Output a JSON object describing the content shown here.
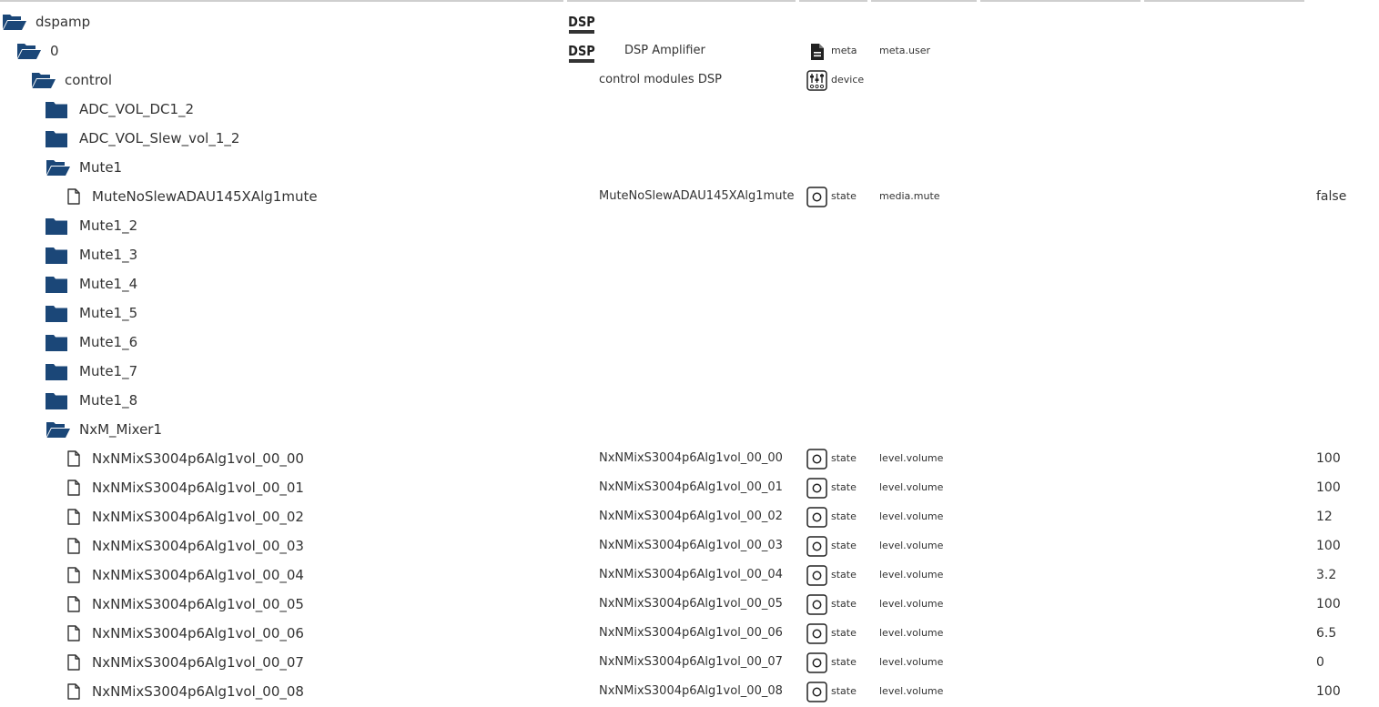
{
  "colors": {
    "folder": "#1b4778",
    "text": "#333333",
    "header_line": "#cfcfcf"
  },
  "rows": [
    {
      "kind": "folder-open",
      "label": "dspamp",
      "logo": "DSP",
      "name": "",
      "type": "",
      "type_icon": "",
      "role": "",
      "value": ""
    },
    {
      "kind": "folder-open",
      "label": "0",
      "logo": "DSP",
      "name": "DSP Amplifier",
      "type": "meta",
      "type_icon": "document-icon",
      "role": "meta.user",
      "value": ""
    },
    {
      "kind": "folder-open",
      "label": "control",
      "logo": "",
      "name": "control modules DSP",
      "type": "device",
      "type_icon": "device-icon",
      "role": "",
      "value": ""
    },
    {
      "kind": "folder",
      "label": "ADC_VOL_DC1_2",
      "name": "",
      "type": "",
      "type_icon": "",
      "role": "",
      "value": ""
    },
    {
      "kind": "folder",
      "label": "ADC_VOL_Slew_vol_1_2",
      "name": "",
      "type": "",
      "type_icon": "",
      "role": "",
      "value": ""
    },
    {
      "kind": "folder-open",
      "label": "Mute1",
      "name": "",
      "type": "",
      "type_icon": "",
      "role": "",
      "value": ""
    },
    {
      "kind": "file",
      "label": "MuteNoSlewADAU145XAlg1mute",
      "name": "MuteNoSlewADAU145XAlg1mute",
      "type": "state",
      "type_icon": "state-icon",
      "role": "media.mute",
      "value": "false"
    },
    {
      "kind": "folder",
      "label": "Mute1_2",
      "name": "",
      "type": "",
      "type_icon": "",
      "role": "",
      "value": ""
    },
    {
      "kind": "folder",
      "label": "Mute1_3",
      "name": "",
      "type": "",
      "type_icon": "",
      "role": "",
      "value": ""
    },
    {
      "kind": "folder",
      "label": "Mute1_4",
      "name": "",
      "type": "",
      "type_icon": "",
      "role": "",
      "value": ""
    },
    {
      "kind": "folder",
      "label": "Mute1_5",
      "name": "",
      "type": "",
      "type_icon": "",
      "role": "",
      "value": ""
    },
    {
      "kind": "folder",
      "label": "Mute1_6",
      "name": "",
      "type": "",
      "type_icon": "",
      "role": "",
      "value": ""
    },
    {
      "kind": "folder",
      "label": "Mute1_7",
      "name": "",
      "type": "",
      "type_icon": "",
      "role": "",
      "value": ""
    },
    {
      "kind": "folder",
      "label": "Mute1_8",
      "name": "",
      "type": "",
      "type_icon": "",
      "role": "",
      "value": ""
    },
    {
      "kind": "folder-open",
      "label": "NxM_Mixer1",
      "name": "",
      "type": "",
      "type_icon": "",
      "role": "",
      "value": ""
    },
    {
      "kind": "file",
      "label": "NxNMixS3004p6Alg1vol_00_00",
      "name": "NxNMixS3004p6Alg1vol_00_00",
      "type": "state",
      "type_icon": "state-icon",
      "role": "level.volume",
      "value": "100"
    },
    {
      "kind": "file",
      "label": "NxNMixS3004p6Alg1vol_00_01",
      "name": "NxNMixS3004p6Alg1vol_00_01",
      "type": "state",
      "type_icon": "state-icon",
      "role": "level.volume",
      "value": "100"
    },
    {
      "kind": "file",
      "label": "NxNMixS3004p6Alg1vol_00_02",
      "name": "NxNMixS3004p6Alg1vol_00_02",
      "type": "state",
      "type_icon": "state-icon",
      "role": "level.volume",
      "value": "12"
    },
    {
      "kind": "file",
      "label": "NxNMixS3004p6Alg1vol_00_03",
      "name": "NxNMixS3004p6Alg1vol_00_03",
      "type": "state",
      "type_icon": "state-icon",
      "role": "level.volume",
      "value": "100"
    },
    {
      "kind": "file",
      "label": "NxNMixS3004p6Alg1vol_00_04",
      "name": "NxNMixS3004p6Alg1vol_00_04",
      "type": "state",
      "type_icon": "state-icon",
      "role": "level.volume",
      "value": "3.2"
    },
    {
      "kind": "file",
      "label": "NxNMixS3004p6Alg1vol_00_05",
      "name": "NxNMixS3004p6Alg1vol_00_05",
      "type": "state",
      "type_icon": "state-icon",
      "role": "level.volume",
      "value": "100"
    },
    {
      "kind": "file",
      "label": "NxNMixS3004p6Alg1vol_00_06",
      "name": "NxNMixS3004p6Alg1vol_00_06",
      "type": "state",
      "type_icon": "state-icon",
      "role": "level.volume",
      "value": "6.5"
    },
    {
      "kind": "file",
      "label": "NxNMixS3004p6Alg1vol_00_07",
      "name": "NxNMixS3004p6Alg1vol_00_07",
      "type": "state",
      "type_icon": "state-icon",
      "role": "level.volume",
      "value": "0"
    },
    {
      "kind": "file",
      "label": "NxNMixS3004p6Alg1vol_00_08",
      "name": "NxNMixS3004p6Alg1vol_00_08",
      "type": "state",
      "type_icon": "state-icon",
      "role": "level.volume",
      "value": "100"
    }
  ]
}
